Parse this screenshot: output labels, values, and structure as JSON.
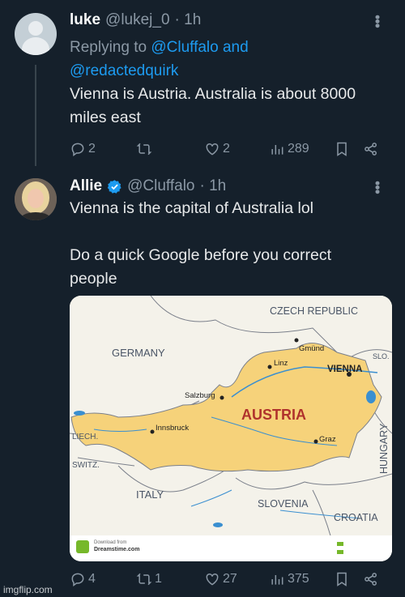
{
  "tweet1": {
    "name": "luke",
    "handle": "@lukej_0",
    "time": "· 1h",
    "replying_prefix": "Replying to",
    "reply_mention_1": "@Cluffalo and",
    "reply_mention_2": "@redactedquirk",
    "text_line1": "Vienna is Austria. Australia is about 8000",
    "text_line2": "miles east",
    "replies": "2",
    "retweets": "",
    "likes": "2",
    "views": "289"
  },
  "tweet2": {
    "name": "Allie",
    "handle": "@Cluffalo",
    "time": "· 1h",
    "text_line1": "Vienna is the capital of Australia lol",
    "text_line2": "Do a quick Google before you correct",
    "text_line3": "people",
    "replies": "4",
    "retweets": "1",
    "likes": "27",
    "views": "375"
  },
  "map": {
    "czech": "CZECH REPUBLIC",
    "germany": "GERMANY",
    "austria": "AUSTRIA",
    "liech": "LIECH.",
    "switz": "SWITZ.",
    "italy": "ITALY",
    "slovenia": "SLOVENIA",
    "croatia": "CROATIA",
    "hungary": "HUNGARY",
    "slo": "SLO.",
    "vienna": "VIENNA",
    "gmund": "Gmünd",
    "linz": "Linz",
    "salzburg": "Salzburg",
    "innsbruck": "Innsbruck",
    "graz": "Graz",
    "download_line1": "Download from",
    "download_line2": "Dreamstime.com"
  },
  "watermark": "imgflip.com",
  "colors": {
    "background": "#15202b",
    "link": "#1d9bf0",
    "muted": "#8b98a5",
    "austria_fill": "#f6d27a",
    "austria_label": "#b0322c"
  }
}
